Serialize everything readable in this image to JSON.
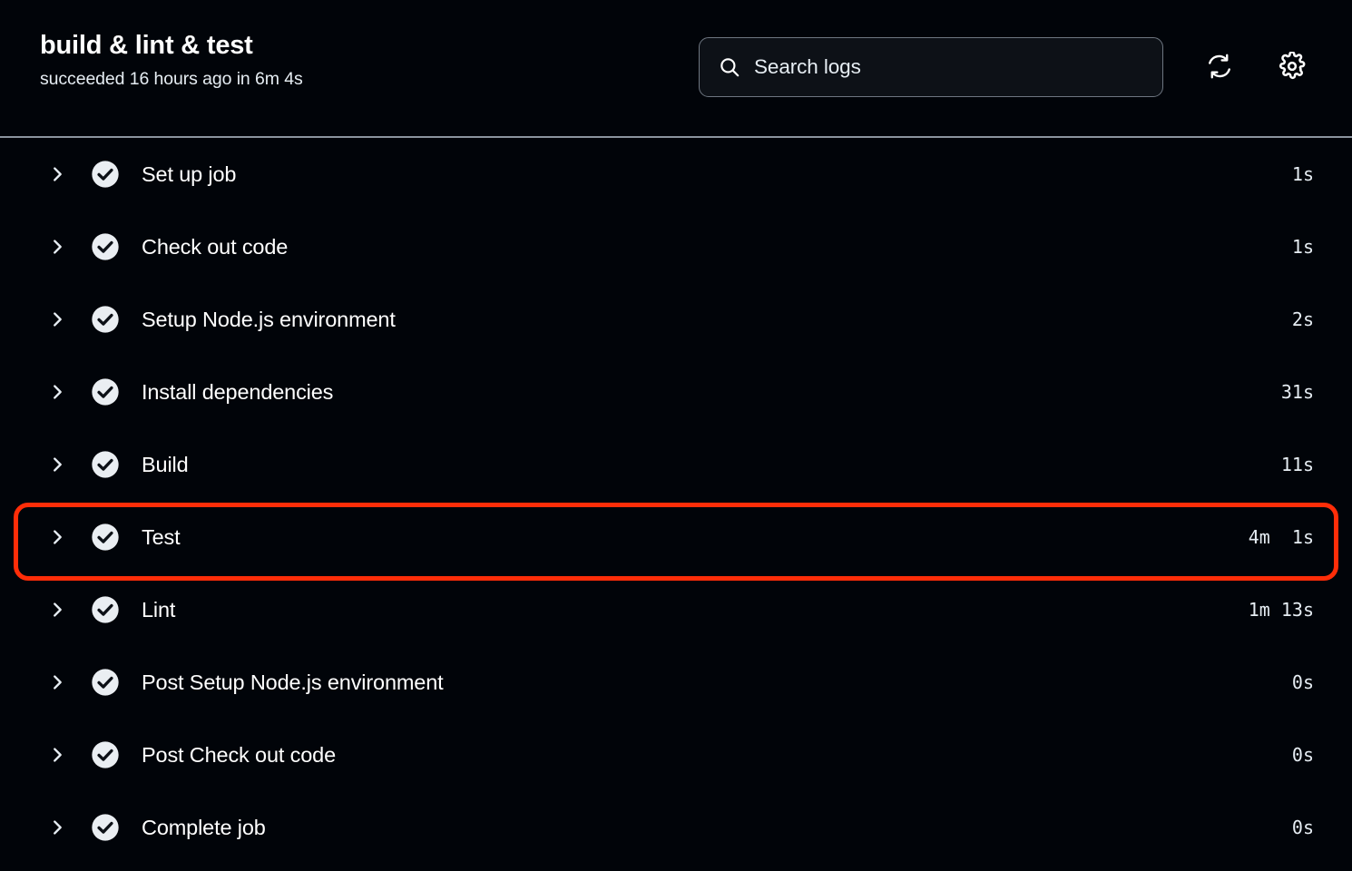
{
  "header": {
    "title": "build & lint & test",
    "status": "succeeded 16 hours ago in 6m 4s",
    "search": {
      "placeholder": "Search logs",
      "value": "",
      "icon": "search-icon"
    },
    "refresh_icon": "refresh-icon",
    "settings_icon": "gear-icon"
  },
  "steps": [
    {
      "label": "Set up job",
      "duration": "1s",
      "status": "success",
      "expand_icon": "chevron-right-icon",
      "status_icon": "check-circle-icon",
      "highlighted": false
    },
    {
      "label": "Check out code",
      "duration": "1s",
      "status": "success",
      "expand_icon": "chevron-right-icon",
      "status_icon": "check-circle-icon",
      "highlighted": false
    },
    {
      "label": "Setup Node.js environment",
      "duration": "2s",
      "status": "success",
      "expand_icon": "chevron-right-icon",
      "status_icon": "check-circle-icon",
      "highlighted": false
    },
    {
      "label": "Install dependencies",
      "duration": "31s",
      "status": "success",
      "expand_icon": "chevron-right-icon",
      "status_icon": "check-circle-icon",
      "highlighted": false
    },
    {
      "label": "Build",
      "duration": "11s",
      "status": "success",
      "expand_icon": "chevron-right-icon",
      "status_icon": "check-circle-icon",
      "highlighted": false
    },
    {
      "label": "Test",
      "duration": "4m  1s",
      "status": "success",
      "expand_icon": "chevron-right-icon",
      "status_icon": "check-circle-icon",
      "highlighted": true
    },
    {
      "label": "Lint",
      "duration": "1m 13s",
      "status": "success",
      "expand_icon": "chevron-right-icon",
      "status_icon": "check-circle-icon",
      "highlighted": false
    },
    {
      "label": "Post Setup Node.js environment",
      "duration": "0s",
      "status": "success",
      "expand_icon": "chevron-right-icon",
      "status_icon": "check-circle-icon",
      "highlighted": false
    },
    {
      "label": "Post Check out code",
      "duration": "0s",
      "status": "success",
      "expand_icon": "chevron-right-icon",
      "status_icon": "check-circle-icon",
      "highlighted": false
    },
    {
      "label": "Complete job",
      "duration": "0s",
      "status": "success",
      "expand_icon": "chevron-right-icon",
      "status_icon": "check-circle-icon",
      "highlighted": false
    }
  ],
  "colors": {
    "background": "#010409",
    "text": "#ffffff",
    "muted_text": "#e6edf3",
    "divider": "#8b949e",
    "success_icon_bg": "#eaeef2",
    "success_icon_check": "#0d1117",
    "highlight_ring": "#ff2d08",
    "search_border": "#6e7681"
  }
}
